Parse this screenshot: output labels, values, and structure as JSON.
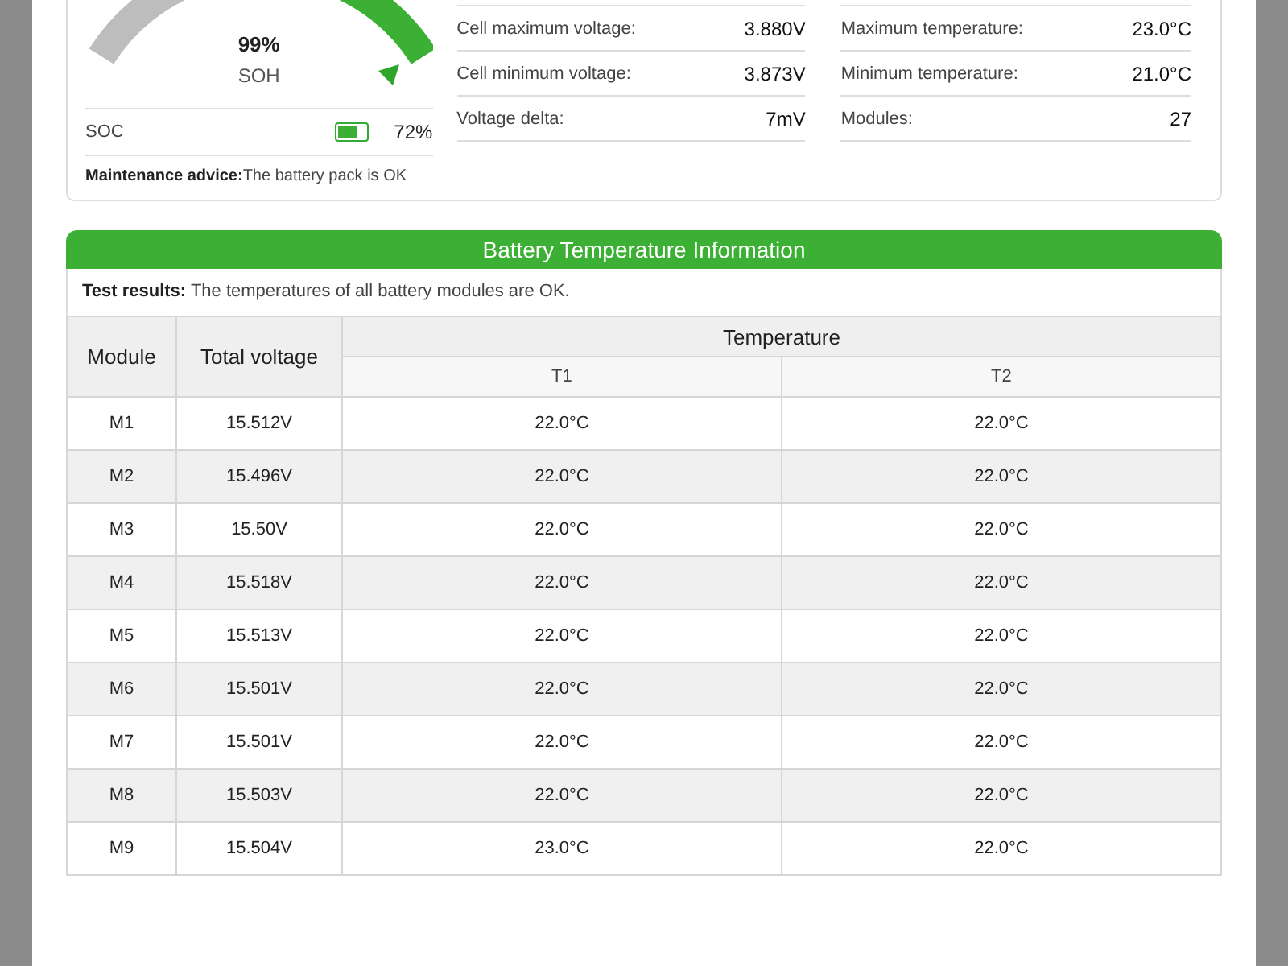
{
  "summary": {
    "soh": {
      "value": "99%",
      "label": "SOH"
    },
    "soc": {
      "label": "SOC",
      "value": "72%",
      "level": 0.72
    },
    "advice": {
      "label": "Maintenance advice:",
      "text": "The battery pack is OK"
    },
    "stats_left": [
      {
        "label": "Cell maximum voltage:",
        "value": "3.880V"
      },
      {
        "label": "Cell minimum voltage:",
        "value": "3.873V"
      },
      {
        "label": "Voltage delta:",
        "value": "7mV"
      }
    ],
    "stats_right": [
      {
        "label": "Maximum temperature:",
        "value": "23.0°C"
      },
      {
        "label": "Minimum temperature:",
        "value": "21.0°C"
      },
      {
        "label": "Modules:",
        "value": "27"
      }
    ]
  },
  "temperature_section": {
    "title": "Battery Temperature Information",
    "test_results": {
      "label": "Test results:",
      "text": "The temperatures of all battery modules are OK."
    },
    "columns": {
      "module": "Module",
      "total_voltage": "Total voltage",
      "temperature": "Temperature",
      "sub": [
        "T1",
        "T2"
      ]
    },
    "rows": [
      {
        "module": "M1",
        "voltage": "15.512V",
        "t1": "22.0°C",
        "t2": "22.0°C"
      },
      {
        "module": "M2",
        "voltage": "15.496V",
        "t1": "22.0°C",
        "t2": "22.0°C"
      },
      {
        "module": "M3",
        "voltage": "15.50V",
        "t1": "22.0°C",
        "t2": "22.0°C"
      },
      {
        "module": "M4",
        "voltage": "15.518V",
        "t1": "22.0°C",
        "t2": "22.0°C"
      },
      {
        "module": "M5",
        "voltage": "15.513V",
        "t1": "22.0°C",
        "t2": "22.0°C"
      },
      {
        "module": "M6",
        "voltage": "15.501V",
        "t1": "22.0°C",
        "t2": "22.0°C"
      },
      {
        "module": "M7",
        "voltage": "15.501V",
        "t1": "22.0°C",
        "t2": "22.0°C"
      },
      {
        "module": "M8",
        "voltage": "15.503V",
        "t1": "22.0°C",
        "t2": "22.0°C"
      },
      {
        "module": "M9",
        "voltage": "15.504V",
        "t1": "23.0°C",
        "t2": "22.0°C"
      }
    ]
  }
}
